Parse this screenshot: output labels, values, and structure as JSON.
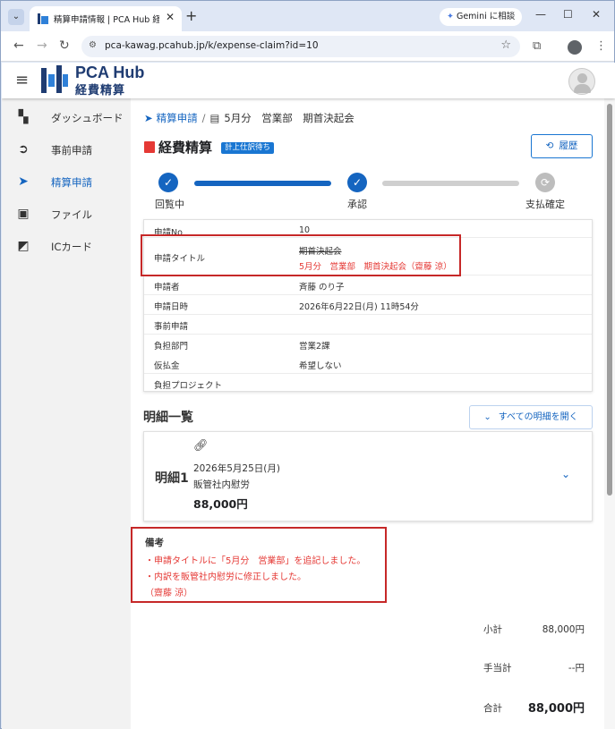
{
  "browser": {
    "tab_title": "精算申請情報 | PCA Hub 経費精算",
    "tab_close": "✕",
    "new_tab": "+",
    "gemini_label": "Gemini に相談",
    "url": "pca-kawag.pcahub.jp/k/expense-claim?id=10"
  },
  "header": {
    "logo_line1": "PCA Hub",
    "logo_line2": "経費精算"
  },
  "sidebar": {
    "items": [
      {
        "label": "ダッシュボード",
        "icon": "dashboard-icon"
      },
      {
        "label": "事前申請",
        "icon": "pre-application-icon"
      },
      {
        "label": "精算申請",
        "icon": "send-icon"
      },
      {
        "label": "ファイル",
        "icon": "image-icon"
      },
      {
        "label": "ICカード",
        "icon": "ic-card-icon"
      }
    ],
    "active_index": 2
  },
  "breadcrumb": {
    "parent": "精算申請",
    "separator": "/",
    "current": "5月分　営業部　期首決起会"
  },
  "page": {
    "title": "経費精算",
    "status_badge": "計上仕訳待ち",
    "history_button": "履歴"
  },
  "stepper": {
    "steps": [
      {
        "label": "回覧中",
        "status": "done"
      },
      {
        "label": "承認",
        "status": "done"
      },
      {
        "label": "支払確定",
        "status": "pending"
      }
    ]
  },
  "info": {
    "rows": [
      {
        "key": "申請No",
        "value": "10"
      },
      {
        "key": "申請タイトル",
        "value_old": "期首決起会",
        "value_new": "5月分　営業部　期首決起会（齋藤 涼）"
      },
      {
        "key": "申請者",
        "value": "斉藤 のり子"
      },
      {
        "key": "申請日時",
        "value": "2026年6月22日(月) 11時54分"
      },
      {
        "key": "事前申請",
        "value": ""
      },
      {
        "key": "負担部門",
        "value": "営業2課"
      },
      {
        "key": "仮払金",
        "value": "希望しない"
      },
      {
        "key": "負担プロジェクト",
        "value": ""
      }
    ]
  },
  "details": {
    "section_title": "明細一覧",
    "expand_all_button": "すべての明細を開く",
    "items": [
      {
        "no": "明細1",
        "date": "2026年5月25日(月)",
        "category": "販管社内慰労",
        "amount": "88,000円"
      }
    ]
  },
  "note": {
    "title": "備考",
    "lines": [
      "・申請タイトルに「5月分　営業部」を追記しました。",
      "・内訳を販管社内慰労に修正しました。",
      "（齋藤 涼）"
    ]
  },
  "totals": {
    "subtotal_label": "小計",
    "subtotal": "88,000円",
    "allowance_label": "手当計",
    "allowance": "--円",
    "total_label": "合計",
    "total": "88,000円"
  },
  "colors": {
    "accent": "#1565c0",
    "highlight_border": "#c62828",
    "edit_text": "#e53935"
  }
}
